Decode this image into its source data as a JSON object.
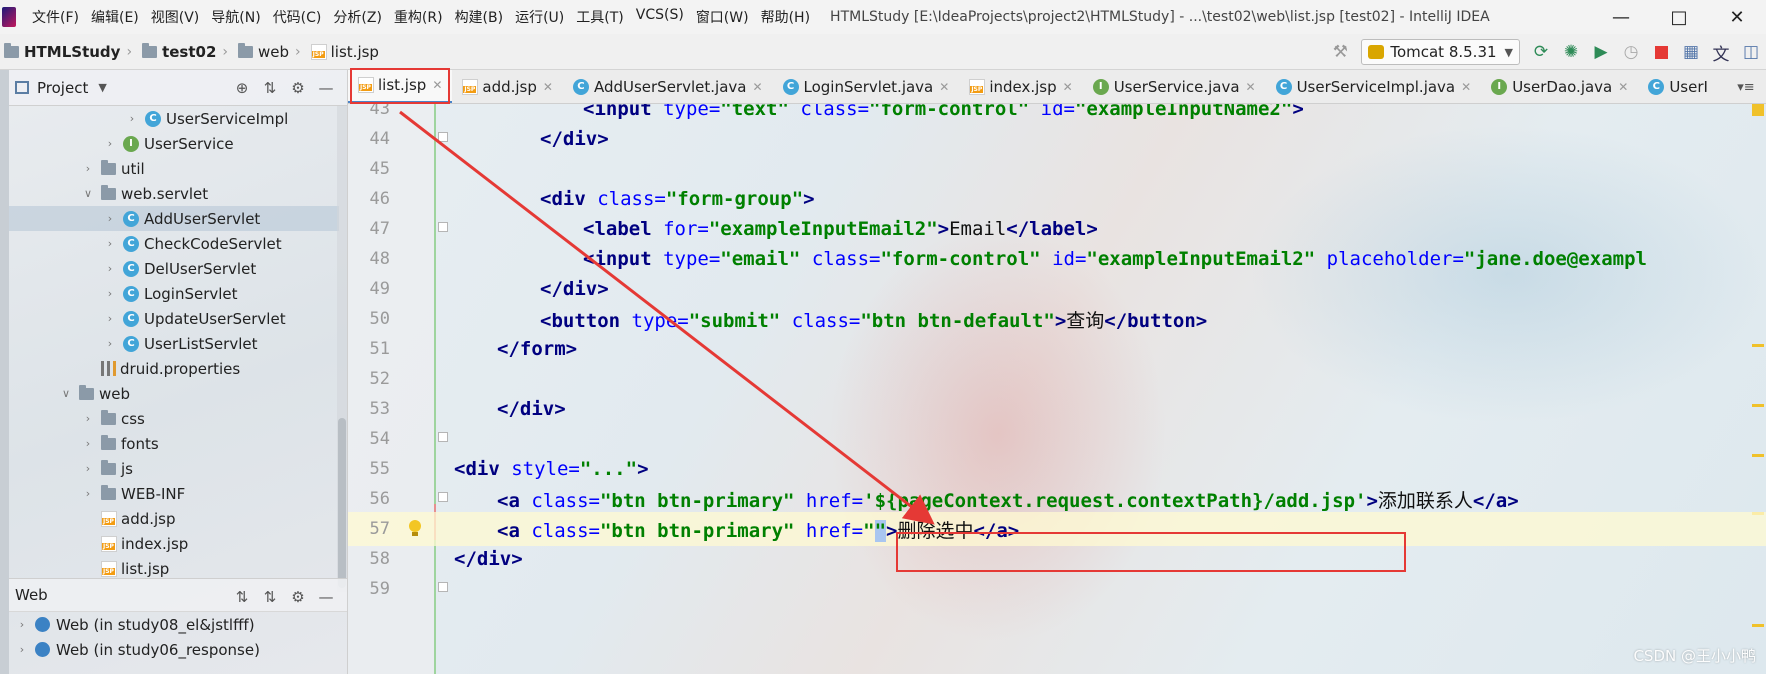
{
  "menu": {
    "items": [
      "文件(F)",
      "编辑(E)",
      "视图(V)",
      "导航(N)",
      "代码(C)",
      "分析(Z)",
      "重构(R)",
      "构建(B)",
      "运行(U)",
      "工具(T)",
      "VCS(S)",
      "窗口(W)",
      "帮助(H)"
    ],
    "window_title": "HTMLStudy [E:\\IdeaProjects\\project2\\HTMLStudy] - ...\\test02\\web\\list.jsp [test02] - IntelliJ IDEA"
  },
  "breadcrumb": [
    "HTMLStudy",
    "test02",
    "web",
    "list.jsp"
  ],
  "run_config": "Tomcat 8.5.31",
  "project_panel": {
    "title": "Project",
    "tree": [
      {
        "label": "UserServiceImpl",
        "type": "class",
        "indent": 3
      },
      {
        "label": "UserService",
        "type": "interface",
        "indent": 2
      },
      {
        "label": "util",
        "type": "folder",
        "indent": 1
      },
      {
        "label": "web.servlet",
        "type": "folder",
        "indent": 1,
        "expanded": true
      },
      {
        "label": "AddUserServlet",
        "type": "class",
        "indent": 2,
        "selected": true
      },
      {
        "label": "CheckCodeServlet",
        "type": "class",
        "indent": 2
      },
      {
        "label": "DelUserServlet",
        "type": "class",
        "indent": 2
      },
      {
        "label": "LoginServlet",
        "type": "class",
        "indent": 2
      },
      {
        "label": "UpdateUserServlet",
        "type": "class",
        "indent": 2
      },
      {
        "label": "UserListServlet",
        "type": "class",
        "indent": 2
      },
      {
        "label": "druid.properties",
        "type": "props",
        "indent": 1
      },
      {
        "label": "web",
        "type": "folder",
        "indent": 0,
        "expanded": true
      },
      {
        "label": "css",
        "type": "folder",
        "indent": 1
      },
      {
        "label": "fonts",
        "type": "folder",
        "indent": 1
      },
      {
        "label": "js",
        "type": "folder",
        "indent": 1
      },
      {
        "label": "WEB-INF",
        "type": "folder",
        "indent": 1
      },
      {
        "label": "add.jsp",
        "type": "jsp",
        "indent": 1
      },
      {
        "label": "index.jsp",
        "type": "jsp",
        "indent": 1
      },
      {
        "label": "list.jsp",
        "type": "jsp",
        "indent": 1
      }
    ]
  },
  "web_panel": {
    "title": "Web",
    "items": [
      "Web (in study08_el&jstlfff)",
      "Web (in study06_response)"
    ]
  },
  "tabs": [
    {
      "label": "list.jsp",
      "type": "jsp",
      "active": true
    },
    {
      "label": "add.jsp",
      "type": "jsp"
    },
    {
      "label": "AddUserServlet.java",
      "type": "class"
    },
    {
      "label": "LoginServlet.java",
      "type": "class"
    },
    {
      "label": "index.jsp",
      "type": "jsp"
    },
    {
      "label": "UserService.java",
      "type": "interface"
    },
    {
      "label": "UserServiceImpl.java",
      "type": "class"
    },
    {
      "label": "UserDao.java",
      "type": "interface"
    },
    {
      "label": "UserI",
      "type": "class"
    }
  ],
  "code_lines": [
    {
      "n": "43",
      "html": "        <span class=\"tag\">&lt;input</span> <span class=\"attr\">type=</span><span class=\"val\">\"text\"</span> <span class=\"attr\">class=</span><span class=\"val\">\"form-control\"</span> <span class=\"attr\">id=</span><span class=\"val\">\"exampleInputName2\"</span><span class=\"tag\">&gt;</span>"
    },
    {
      "n": "44",
      "html": "    <span class=\"tag\">&lt;/div&gt;</span>"
    },
    {
      "n": "45",
      "html": ""
    },
    {
      "n": "46",
      "html": "    <span class=\"tag\">&lt;div</span> <span class=\"attr\">class=</span><span class=\"val\">\"form-group\"</span><span class=\"tag\">&gt;</span>"
    },
    {
      "n": "47",
      "html": "        <span class=\"tag\">&lt;label</span> <span class=\"attr\">for=</span><span class=\"val\">\"exampleInputEmail2\"</span><span class=\"tag\">&gt;</span>Email<span class=\"tag\">&lt;/label&gt;</span>"
    },
    {
      "n": "48",
      "html": "        <span class=\"tag\">&lt;input</span> <span class=\"attr\">type=</span><span class=\"val\">\"email\"</span> <span class=\"attr\">class=</span><span class=\"val\">\"form-control\"</span> <span class=\"attr\">id=</span><span class=\"val\">\"exampleInputEmail2\"</span> <span class=\"attr\">placeholder=</span><span class=\"val\">\"jane.doe@exampl</span>"
    },
    {
      "n": "49",
      "html": "    <span class=\"tag\">&lt;/div&gt;</span>"
    },
    {
      "n": "50",
      "html": "    <span class=\"tag\">&lt;button</span> <span class=\"attr\">type=</span><span class=\"val\">\"submit\"</span> <span class=\"attr\">class=</span><span class=\"val\">\"btn btn-default\"</span><span class=\"tag\">&gt;</span>查询<span class=\"tag\">&lt;/button&gt;</span>"
    },
    {
      "n": "51",
      "html": "  <span class=\"tag\">&lt;/form&gt;</span>"
    },
    {
      "n": "52",
      "html": ""
    },
    {
      "n": "53",
      "html": "<span class=\"tag\">&lt;/div&gt;</span>"
    },
    {
      "n": "54",
      "html": ""
    },
    {
      "n": "55",
      "html": "<span class=\"tag\">&lt;div</span> <span class=\"attr\">style=</span><span class=\"val\">\"...\"</span><span class=\"tag\">&gt;</span>"
    },
    {
      "n": "56",
      "html": "    <span class=\"tag\">&lt;a</span> <span class=\"attr\">class=</span><span class=\"val\">\"btn btn-primary\"</span> <span class=\"attr\">href=</span><span class=\"val\">'</span><span class=\"el\">${pageContext.request.contextPath}</span><span class=\"val\">/add.jsp'</span><span class=\"tag\">&gt;</span>添加联系人<span class=\"tag\">&lt;/a&gt;</span>"
    },
    {
      "n": "57",
      "html": "    <span class=\"tag\">&lt;a</span> <span class=\"attr\">class=</span><span class=\"val\">\"btn btn-primary\"</span> <span class=\"attr\">href=</span><span class=\"val\">\"<span class=\"cursor\">\"</span></span><span class=\"tag\">&gt;</span>删除选中<span class=\"tag\">&lt;/a&gt;</span>"
    },
    {
      "n": "58",
      "html": "<span class=\"tag\">&lt;/div&gt;</span>"
    },
    {
      "n": "59",
      "html": ""
    }
  ],
  "code_indent": [
    2,
    1,
    0,
    1,
    2,
    2,
    1,
    1,
    0,
    0,
    0,
    0,
    -1,
    0,
    0,
    -1,
    0
  ],
  "watermark": "CSDN @王小小鸭"
}
